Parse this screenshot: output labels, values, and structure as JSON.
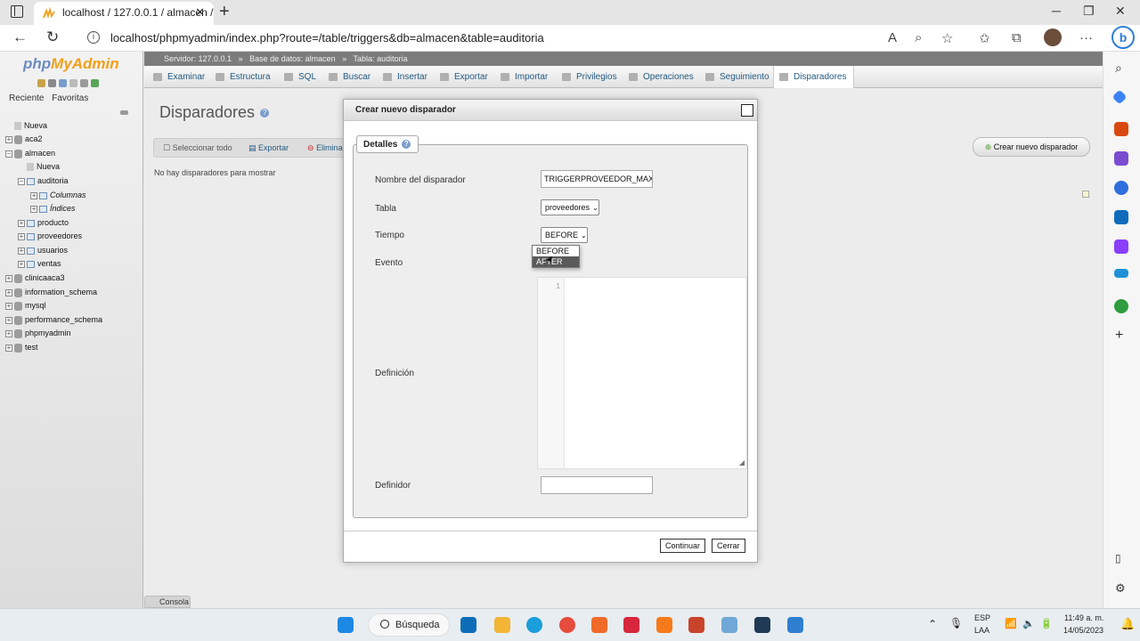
{
  "browser": {
    "tab_title": "localhost / 127.0.0.1 / almacen /",
    "url": "localhost/phpmyadmin/index.php?route=/table/triggers&db=almacen&table=auditoria"
  },
  "pma": {
    "logo_a": "php",
    "logo_b": "MyAdmin",
    "nav_tabs": [
      "Reciente",
      "Favoritas"
    ],
    "tree": [
      {
        "label": "Nueva",
        "level": 0,
        "icon": "new"
      },
      {
        "label": "aca2",
        "level": 0,
        "icon": "db"
      },
      {
        "label": "almacen",
        "level": 0,
        "icon": "db"
      },
      {
        "label": "Nueva",
        "level": 1,
        "icon": "new"
      },
      {
        "label": "auditoria",
        "level": 1,
        "icon": "table"
      },
      {
        "label": "Columnas",
        "level": 2,
        "icon": "folder"
      },
      {
        "label": "Índices",
        "level": 2,
        "icon": "folder"
      },
      {
        "label": "producto",
        "level": 1,
        "icon": "table"
      },
      {
        "label": "proveedores",
        "level": 1,
        "icon": "table"
      },
      {
        "label": "usuarios",
        "level": 1,
        "icon": "table"
      },
      {
        "label": "ventas",
        "level": 1,
        "icon": "table"
      },
      {
        "label": "clinicaaca3",
        "level": 0,
        "icon": "db"
      },
      {
        "label": "information_schema",
        "level": 0,
        "icon": "db"
      },
      {
        "label": "mysql",
        "level": 0,
        "icon": "db"
      },
      {
        "label": "performance_schema",
        "level": 0,
        "icon": "db"
      },
      {
        "label": "phpmyadmin",
        "level": 0,
        "icon": "db"
      },
      {
        "label": "test",
        "level": 0,
        "icon": "db"
      }
    ],
    "breadcrumb": [
      "Servidor: 127.0.0.1",
      "»",
      "Base de datos: almacen",
      "»",
      "Tabla: auditoria"
    ],
    "menu": [
      "Examinar",
      "Estructura",
      "SQL",
      "Buscar",
      "Insertar",
      "Exportar",
      "Importar",
      "Privilegios",
      "Operaciones",
      "Seguimiento",
      "Disparadores"
    ],
    "page_title": "Disparadores",
    "actions": [
      "Seleccionar todo",
      "Exportar",
      "Elimina"
    ],
    "no_triggers": "No hay disparadores para mostrar",
    "create_button": "Crear nuevo disparador",
    "console": "Consola"
  },
  "modal": {
    "title": "Crear nuevo disparador",
    "legend": "Detalles",
    "labels": {
      "name": "Nombre del disparador",
      "table": "Tabla",
      "time": "Tiempo",
      "event": "Evento",
      "definition": "Definición",
      "definer": "Definidor"
    },
    "name_value": "TRIGGERPROVEEDOR_MAX",
    "table_value": "proveedores",
    "time_value": "BEFORE",
    "time_options": [
      "BEFORE",
      "AFTER"
    ],
    "time_highlighted": "AFTER",
    "line_number": "1",
    "definer_value": "",
    "continue": "Continuar",
    "close": "Cerrar"
  },
  "taskbar": {
    "search": "Búsqueda",
    "lang": "ESP",
    "lang2": "LAA",
    "time": "11:49 a. m.",
    "date": "14/05/2023"
  },
  "colors": {
    "pma_link": "#235a81",
    "breadcrumb_bg": "#7c7c7c",
    "logo_blue": "#6c8cbf",
    "logo_orange": "#f29f1a"
  }
}
